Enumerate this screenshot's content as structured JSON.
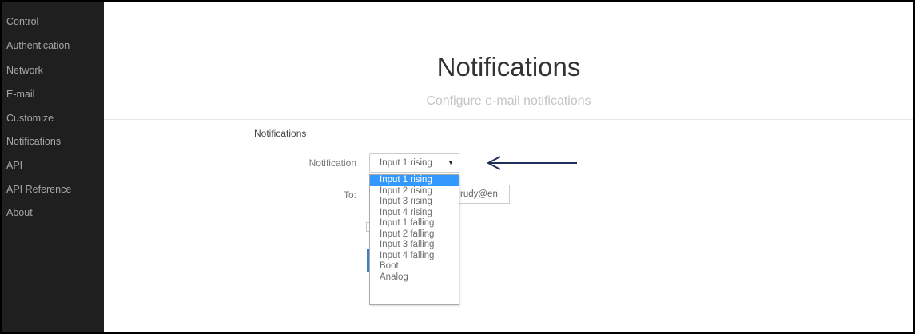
{
  "sidebar": {
    "items": [
      {
        "label": "Control"
      },
      {
        "label": "Authentication"
      },
      {
        "label": "Network"
      },
      {
        "label": "E-mail"
      },
      {
        "label": "Customize"
      },
      {
        "label": "Notifications"
      },
      {
        "label": "API"
      },
      {
        "label": "API Reference"
      },
      {
        "label": "About"
      }
    ]
  },
  "header": {
    "title": "Notifications",
    "subtitle": "Configure e-mail notifications"
  },
  "form": {
    "legend": "Notifications",
    "notification_label": "Notification",
    "notification_value": "Input 1 rising",
    "to_label": "To:",
    "to_value": "rudy@en"
  },
  "dropdown": {
    "options": [
      {
        "label": "Input 1 rising"
      },
      {
        "label": "Input 2 rising"
      },
      {
        "label": "Input 3 rising"
      },
      {
        "label": "Input 4 rising"
      },
      {
        "label": "Input 1 falling"
      },
      {
        "label": "Input 2 falling"
      },
      {
        "label": "Input 3 falling"
      },
      {
        "label": "Input 4 falling"
      },
      {
        "label": "Boot"
      },
      {
        "label": "Analog"
      }
    ]
  },
  "icons": {
    "caret": "chevron-down-icon",
    "arrow": "arrow-left-icon"
  },
  "colors": {
    "sidebar_bg": "#1f1f1f",
    "selection": "#3399ff",
    "arrow": "#1f2f5a"
  }
}
